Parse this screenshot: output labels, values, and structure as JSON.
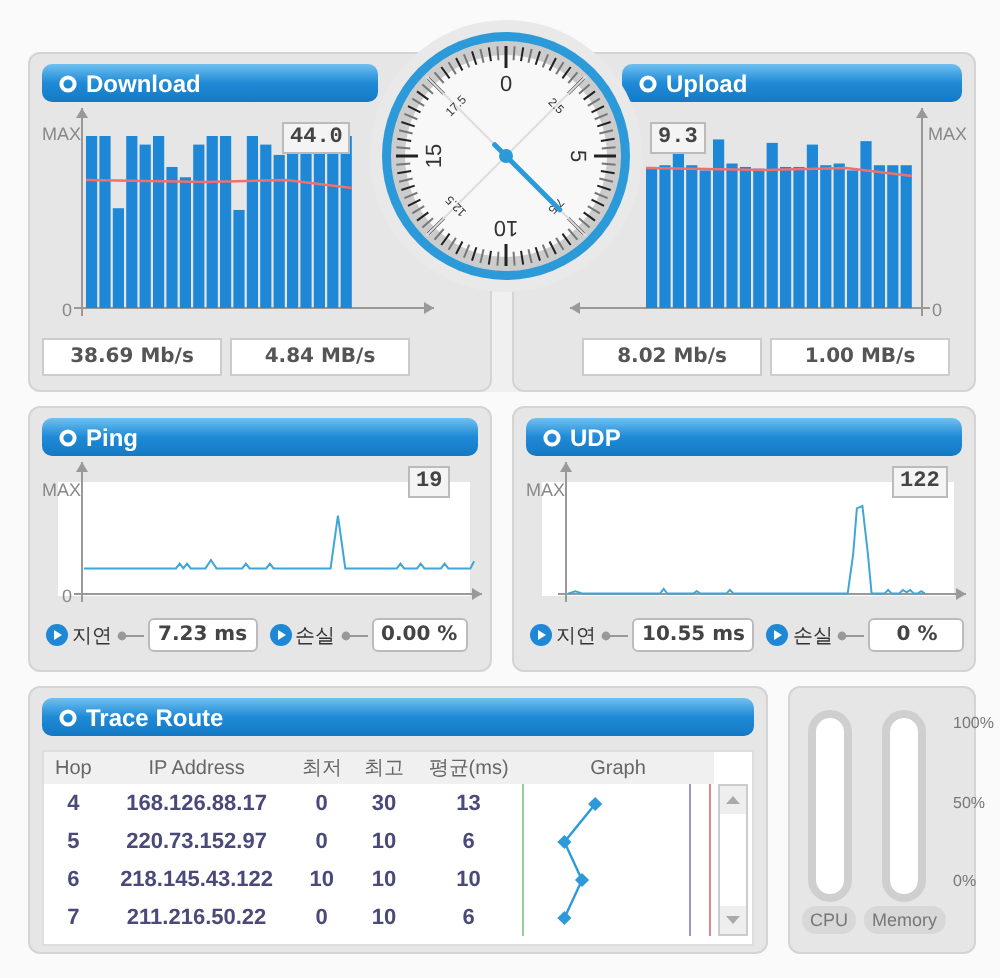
{
  "download": {
    "title": "Download",
    "axis_max": "MAX",
    "axis_zero": "0",
    "peak": "44.0",
    "readings": [
      "38.69 Mb/s",
      "4.84 MB/s"
    ]
  },
  "gauge": {
    "labels": [
      "0",
      "2.5",
      "5",
      "7.5",
      "10",
      "12.5",
      "15",
      "17.5"
    ]
  },
  "upload": {
    "title": "Upload",
    "axis_max": "MAX",
    "axis_zero": "0",
    "peak": "9.3",
    "readings": [
      "8.02 Mb/s",
      "1.00 MB/s"
    ]
  },
  "ping": {
    "title": "Ping",
    "axis_max": "MAX",
    "axis_zero": "0",
    "peak": "19",
    "stats": [
      {
        "label": "지연",
        "value": "7.23 ms"
      },
      {
        "label": "손실",
        "value": "0.00 %"
      }
    ]
  },
  "udp": {
    "title": "UDP",
    "axis_max": "MAX",
    "peak": "122",
    "stats": [
      {
        "label": "지연",
        "value": "10.55 ms"
      },
      {
        "label": "손실",
        "value": "0 %"
      }
    ]
  },
  "trace_route": {
    "title": "Trace Route",
    "columns": [
      "Hop",
      "IP Address",
      "최저",
      "최고",
      "평균(ms)",
      "Graph"
    ],
    "rows": [
      [
        "4",
        "168.126.88.17",
        "0",
        "30",
        "13"
      ],
      [
        "5",
        "220.73.152.97",
        "0",
        "10",
        "6"
      ],
      [
        "6",
        "218.145.43.122",
        "10",
        "10",
        "10"
      ],
      [
        "7",
        "211.216.50.22",
        "0",
        "10",
        "6"
      ]
    ]
  },
  "system_meters": {
    "scale": [
      "100%",
      "50%",
      "0%"
    ],
    "meters": [
      {
        "label": "CPU"
      },
      {
        "label": "Memory"
      }
    ]
  }
}
